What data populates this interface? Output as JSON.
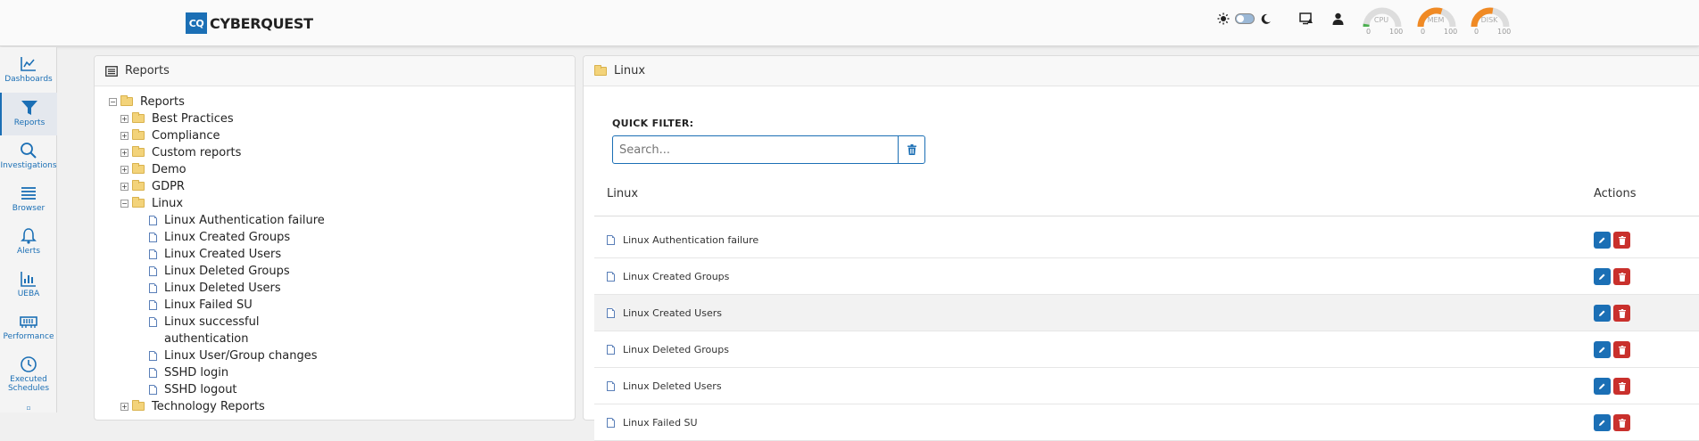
{
  "app": {
    "logo_badge": "CQ",
    "logo_text": "CYBERQUEST"
  },
  "gauges": [
    {
      "label": "CPU",
      "min": "0",
      "max": "100",
      "value": 5,
      "color": "#4caf50"
    },
    {
      "label": "MEM",
      "min": "0",
      "max": "100",
      "value": 60,
      "color": "#f08a24"
    },
    {
      "label": "DISK",
      "min": "0",
      "max": "100",
      "value": 55,
      "color": "#f08a24"
    }
  ],
  "sidebar": {
    "items": [
      {
        "label": "Dashboards",
        "icon": "chart-line-icon"
      },
      {
        "label": "Reports",
        "icon": "filter-icon"
      },
      {
        "label": "Investigations",
        "icon": "search-icon"
      },
      {
        "label": "Browser",
        "icon": "list-icon"
      },
      {
        "label": "Alerts",
        "icon": "bell-icon"
      },
      {
        "label": "UEBA",
        "icon": "bar-chart-icon"
      },
      {
        "label": "Performance",
        "icon": "memory-icon"
      },
      {
        "label": "Executed Schedules",
        "icon": "clock-icon"
      }
    ]
  },
  "reports_panel": {
    "title": "Reports",
    "tree": {
      "root": "Reports",
      "folders": [
        "Best Practices",
        "Compliance",
        "Custom reports",
        "Demo",
        "GDPR",
        "Linux"
      ],
      "linux_items": [
        "Linux Authentication failure",
        "Linux Created Groups",
        "Linux Created Users",
        "Linux Deleted Groups",
        "Linux Deleted Users",
        "Linux Failed SU",
        "Linux successful",
        "authentication",
        "Linux User/Group changes",
        "SSHD login",
        "SSHD logout"
      ],
      "next_folder": "Technology Reports"
    }
  },
  "linux_panel": {
    "title": "Linux",
    "quick_filter_label": "QUICK FILTER:",
    "search_placeholder": "Search...",
    "columns": {
      "name": "Linux",
      "actions": "Actions"
    },
    "rows": [
      "Linux Authentication failure",
      "Linux Created Groups",
      "Linux Created Users",
      "Linux Deleted Groups",
      "Linux Deleted Users",
      "Linux Failed SU"
    ]
  },
  "colors": {
    "accent": "#1b6fb5",
    "danger": "#c9302c",
    "folder": "#f3d37a"
  }
}
